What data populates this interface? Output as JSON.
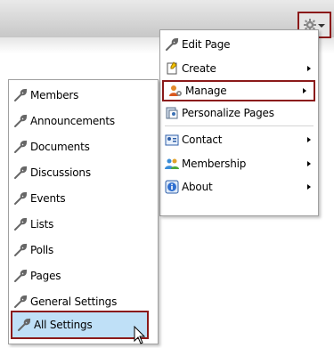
{
  "main_menu": {
    "items": [
      {
        "label": "Edit Page",
        "icon": "wrench-icon"
      },
      {
        "label": "Create",
        "icon": "create-icon"
      },
      {
        "label": "Manage",
        "icon": "manage-icon"
      },
      {
        "label": "Personalize Pages",
        "icon": "personalize-icon"
      },
      {
        "label": "Contact",
        "icon": "contact-icon"
      },
      {
        "label": "Membership",
        "icon": "membership-icon"
      },
      {
        "label": "About",
        "icon": "info-icon"
      }
    ]
  },
  "manage_submenu": {
    "items": [
      {
        "label": "Members"
      },
      {
        "label": "Announcements"
      },
      {
        "label": "Documents"
      },
      {
        "label": "Discussions"
      },
      {
        "label": "Events"
      },
      {
        "label": "Lists"
      },
      {
        "label": "Polls"
      },
      {
        "label": "Pages"
      },
      {
        "label": "General Settings"
      },
      {
        "label": "All Settings"
      }
    ]
  },
  "colors": {
    "highlight_border": "#8b1a1a",
    "selected_background": "#bfe0f7"
  }
}
